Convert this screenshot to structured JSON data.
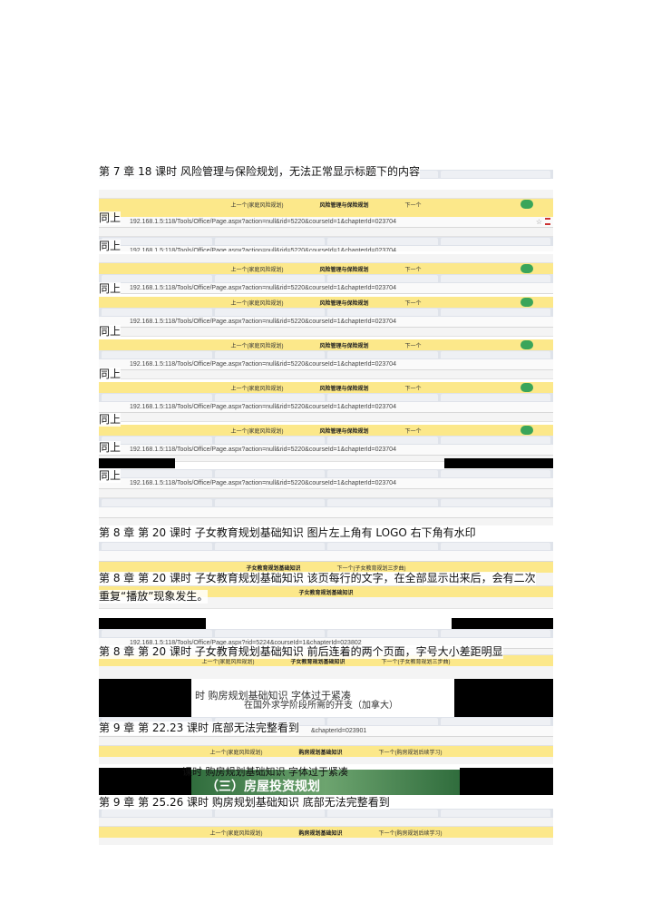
{
  "common": {
    "url": "192.168.1.5:118/Tools/Office/Page.aspx?action=null&rid=5220&courseId=1&chapterId=023704",
    "nav_prev": "上一个(家庭风险规划)",
    "nav_title": "风险管理与保险规划",
    "nav_next": "下一个"
  },
  "captions": [
    "第 7 章  18 课时  风险管理与保险规划，无法正常显示标题下的内容",
    "同上",
    "同上",
    "同上",
    "同上",
    "同上",
    "同上",
    "同上",
    "同上",
    "第 8 章  第 20 课时  子女教育规划基础知识  图片左上角有 LOGO 右下角有水印",
    "第 8 章  第 20 课时  子女教育规划基础知识  该页每行的文字，在全部显示出来后，会有二次",
    "重复“播放”现象发生。",
    "第 8 章 第 20 课时  子女教育规划基础知识  前后连着的两个页面，字号大小差距明显",
    "第 9 章  第 22.23 课时  底部无法完整看到",
    "第 9 章  第 25.26 课时  购房规划基础知识  底部无法完整看到"
  ],
  "ch8": {
    "url": "192.168.1.5:118/Tools/Office/Page.aspx?rid=5224&courseId=1&chapterId=023802",
    "title": "子女教育规划基础知识",
    "next": "下一个(子女教育规划三步曲)",
    "slide_text_1": "时  购房规划基础知识  字体过于紧凑",
    "slide_text_2": "在国外求学阶段所需的开支（加拿大）"
  },
  "ch9": {
    "url": "&chapterId=023901",
    "title": "购房规划基础知识",
    "next": "下一个(购房规划后续学习)",
    "slide_text": "课时  购房规划基础知识  字体过于紧凑",
    "slide_heading": "（三）房屋投资规划"
  }
}
